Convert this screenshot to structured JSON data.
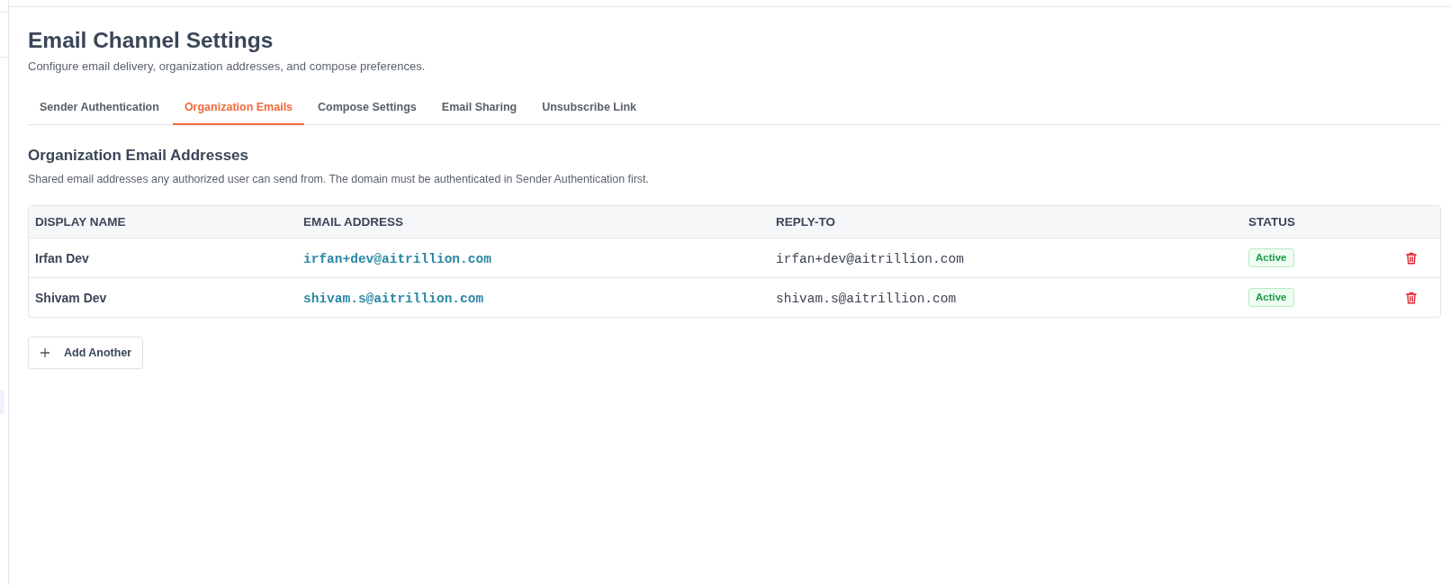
{
  "page": {
    "title": "Email Channel Settings",
    "subtitle": "Configure email delivery, organization addresses, and compose preferences."
  },
  "tabs": [
    {
      "label": "Sender Authentication",
      "selected": false
    },
    {
      "label": "Organization Emails",
      "selected": true
    },
    {
      "label": "Compose Settings",
      "selected": false
    },
    {
      "label": "Email Sharing",
      "selected": false
    },
    {
      "label": "Unsubscribe Link",
      "selected": false
    }
  ],
  "section": {
    "title": "Organization Email Addresses",
    "description": "Shared email addresses any authorized user can send from. The domain must be authenticated in Sender Authentication first."
  },
  "table": {
    "columns": [
      "DISPLAY NAME",
      "EMAIL ADDRESS",
      "REPLY-TO",
      "STATUS"
    ],
    "rows": [
      {
        "display_name": "Irfan Dev",
        "email": "irfan+dev@aitrillion.com",
        "reply_to": "irfan+dev@aitrillion.com",
        "status": "Active"
      },
      {
        "display_name": "Shivam Dev",
        "email": "shivam.s@aitrillion.com",
        "reply_to": "shivam.s@aitrillion.com",
        "status": "Active"
      }
    ]
  },
  "add_button": {
    "label": "Add Another"
  }
}
